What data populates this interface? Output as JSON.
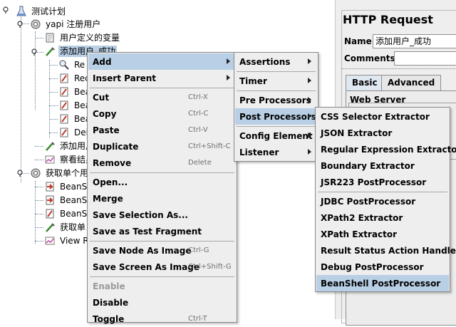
{
  "tree": {
    "root": "测试计划",
    "group1": "yapi 注册用户",
    "udv": "用户定义的变量",
    "sampler1": "添加用户_成功",
    "child_re": "Re",
    "child_rec": "Rec",
    "child_bea1": "Bea",
    "child_bea2": "Bea",
    "child_bea3": "Bea",
    "child_del": "Del",
    "sampler2": "添加用户",
    "result_tree": "察看结身",
    "group2": "获取单个用",
    "bean1": "BeanS",
    "bean2": "BeanS",
    "bean3": "BeanS",
    "get_single": "获取单",
    "view_r": "View R"
  },
  "panel": {
    "title": "HTTP Request",
    "name_label": "Name:",
    "name_value": "添加用户_成功",
    "comments_label": "Comments:",
    "tab_basic": "Basic",
    "tab_advanced": "Advanced",
    "web_server": "Web Server"
  },
  "menu1": {
    "add": "Add",
    "insert_parent": "Insert Parent",
    "cut": "Cut",
    "cut_key": "Ctrl-X",
    "copy": "Copy",
    "copy_key": "Ctrl-C",
    "paste": "Paste",
    "paste_key": "Ctrl-V",
    "duplicate": "Duplicate",
    "duplicate_key": "Ctrl+Shift-C",
    "remove": "Remove",
    "remove_key": "Delete",
    "open": "Open...",
    "merge": "Merge",
    "save_selection": "Save Selection As...",
    "save_fragment": "Save as Test Fragment",
    "save_node_image": "Save Node As Image",
    "save_node_image_key": "Ctrl-G",
    "save_screen_image": "Save Screen As Image",
    "save_screen_image_key": "Ctrl+Shift-G",
    "enable": "Enable",
    "disable": "Disable",
    "toggle": "Toggle",
    "toggle_key": "Ctrl-T"
  },
  "menu2": {
    "assertions": "Assertions",
    "timer": "Timer",
    "pre_processors": "Pre Processors",
    "post_processors": "Post Processors",
    "config_element": "Config Element",
    "listener": "Listener"
  },
  "menu3": {
    "css_selector": "CSS Selector Extractor",
    "json": "JSON Extractor",
    "regex": "Regular Expression Extractor",
    "boundary": "Boundary Extractor",
    "jsr223": "JSR223 PostProcessor",
    "jdbc": "JDBC PostProcessor",
    "xpath2": "XPath2 Extractor",
    "xpath": "XPath Extractor",
    "result_status": "Result Status Action Handler",
    "debug": "Debug PostProcessor",
    "beanshell": "BeanShell PostProcessor"
  },
  "colors": {
    "highlight": "#b8cfe5",
    "menu_bg": "#eeeeee"
  }
}
